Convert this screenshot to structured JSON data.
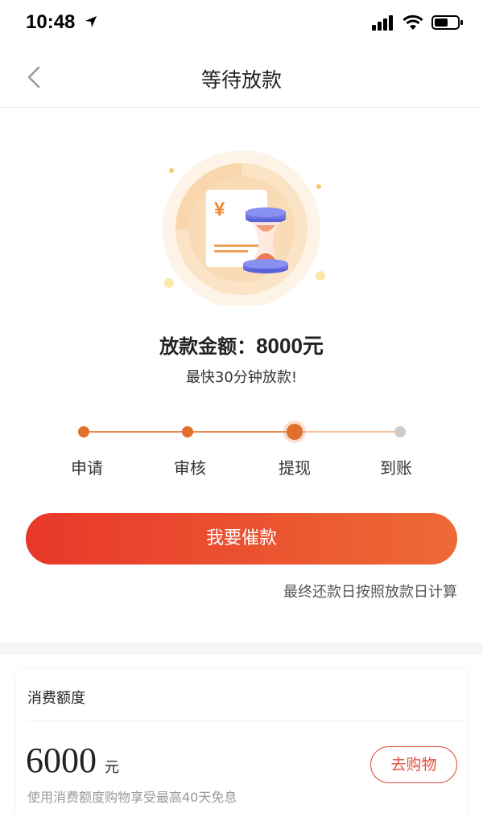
{
  "status_bar": {
    "time": "10:48"
  },
  "nav": {
    "title": "等待放款"
  },
  "loan": {
    "amount_label": "放款金额：",
    "amount_value": "8000元",
    "subtitle": "最快30分钟放款!"
  },
  "steps": [
    {
      "label": "申请",
      "state": "done"
    },
    {
      "label": "审核",
      "state": "done"
    },
    {
      "label": "提现",
      "state": "current"
    },
    {
      "label": "到账",
      "state": "todo"
    }
  ],
  "main_button": {
    "label": "我要催款"
  },
  "note": "最终还款日按照放款日计算",
  "credit_card": {
    "title": "消费额度",
    "amount": "6000",
    "unit": "元",
    "description": "使用消费额度购物享受最高40天免息",
    "shop_button": "去购物"
  },
  "colors": {
    "accent": "#e0702c",
    "button_start": "#e8382a",
    "button_end": "#ed6a36"
  },
  "icons": [
    "location-arrow-icon",
    "signal-icon",
    "wifi-icon",
    "battery-icon",
    "back-chevron-icon",
    "hourglass-document-icon",
    "yen-icon"
  ]
}
